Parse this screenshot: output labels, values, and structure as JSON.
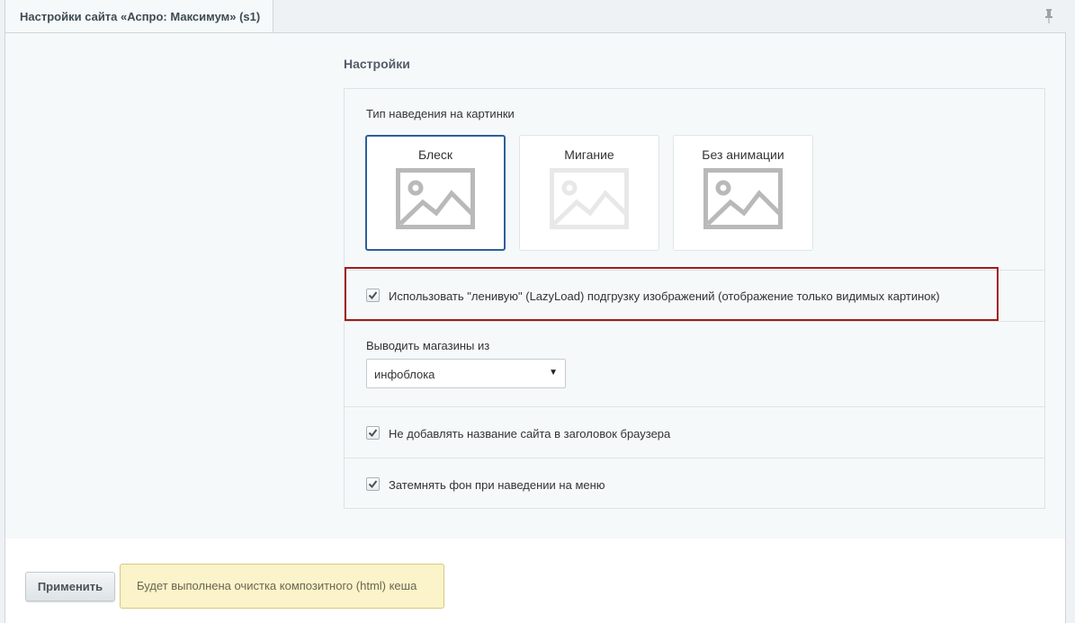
{
  "tab": {
    "title": "Настройки сайта «Аспро: Максимум» (s1)"
  },
  "section": {
    "title": "Настройки"
  },
  "hover": {
    "label": "Тип наведения на картинки",
    "options": [
      {
        "label": "Блеск",
        "selected": true
      },
      {
        "label": "Мигание",
        "selected": false
      },
      {
        "label": "Без анимации",
        "selected": false
      }
    ]
  },
  "lazyload": {
    "label": "Использовать \"ленивую\" (LazyLoad) подгрузку изображений (отображение только видимых картинок)",
    "checked": true
  },
  "stores": {
    "label": "Выводить магазины из",
    "value": "инфоблока"
  },
  "no_site_name": {
    "label": "Не добавлять название сайта в заголовок браузера",
    "checked": true
  },
  "darken_menu": {
    "label": "Затемнять фон при наведении на меню",
    "checked": true
  },
  "footer": {
    "apply_label": "Применить",
    "notice": "Будет выполнена очистка композитного (html) кеша"
  },
  "colors": {
    "highlight": "#a11b1b",
    "selected": "#2f5e9c",
    "notice_bg": "#fbf3c9"
  }
}
